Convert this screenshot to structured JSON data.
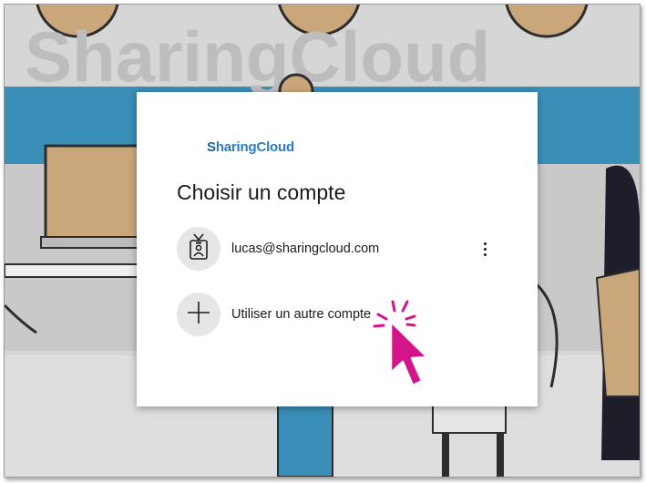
{
  "background": {
    "brand_text": "SharingCloud"
  },
  "dialog": {
    "logo_text": "SharingCloud",
    "title": "Choisir un compte",
    "accounts": [
      {
        "email": "lucas@sharingcloud.com",
        "icon": "id-badge-icon"
      }
    ],
    "add_account_label": "Utiliser un autre compte",
    "add_account_icon": "plus-icon",
    "more_icon": "more-vertical-icon"
  },
  "colors": {
    "brand_blue": "#2a7cc0",
    "cursor_magenta": "#d4148a",
    "backdrop_blue": "#3a8fb8"
  }
}
